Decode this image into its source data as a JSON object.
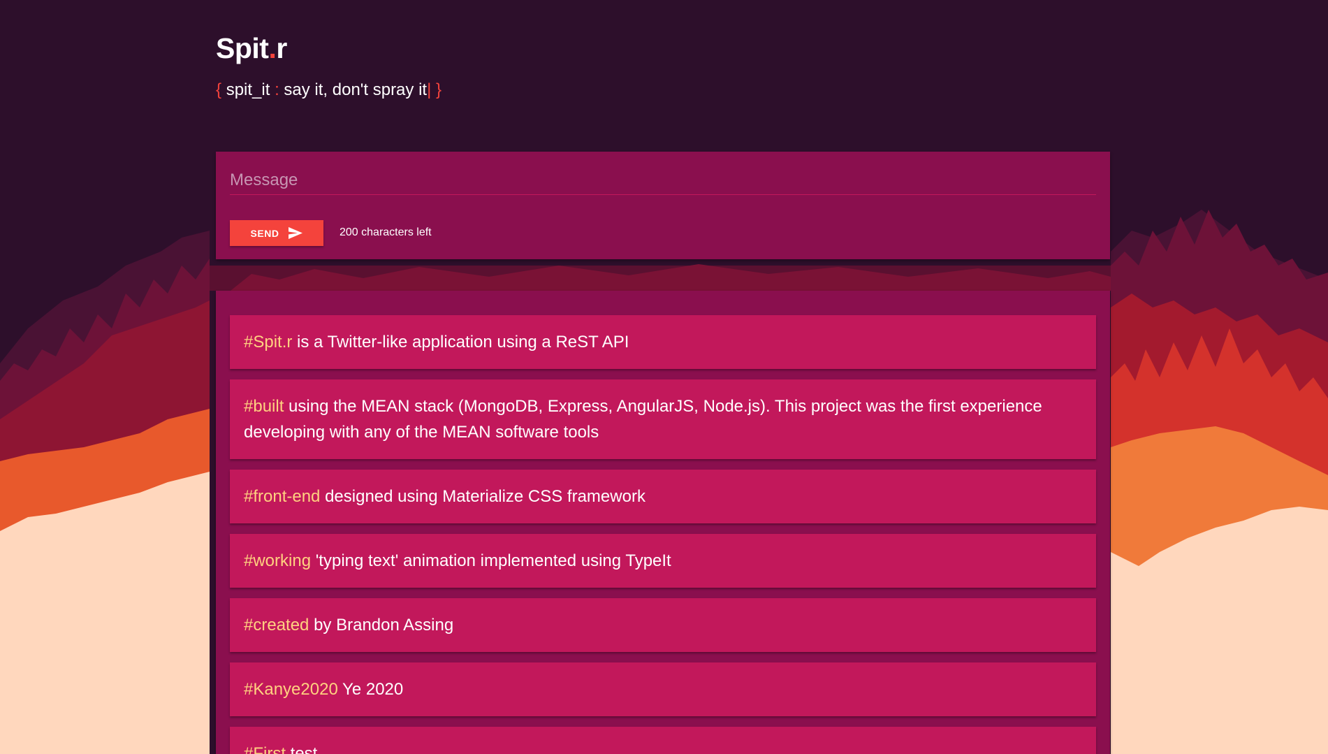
{
  "header": {
    "logo_part1": "Spit",
    "logo_dot": ".",
    "logo_part2": "r",
    "tagline_open_brace": "{",
    "tagline_key": "spit_it",
    "tagline_colon": ":",
    "tagline_text": "say it, don't spray it",
    "tagline_cursor": "|",
    "tagline_close_brace": "}"
  },
  "composer": {
    "placeholder": "Message",
    "send_label": "SEND",
    "chars_left": "200 characters left"
  },
  "posts": [
    {
      "tag": "#Spit.r",
      "text": " is a Twitter-like application using a ReST API"
    },
    {
      "tag": "#built",
      "text": " using the MEAN stack (MongoDB, Express, AngularJS, Node.js). This project was the first experience developing with any of the MEAN software tools"
    },
    {
      "tag": "#front-end",
      "text": " designed using Materialize CSS framework"
    },
    {
      "tag": "#working",
      "text": " 'typing text' animation implemented using TypeIt"
    },
    {
      "tag": "#created",
      "text": " by Brandon Assing"
    },
    {
      "tag": "#Kanye2020",
      "text": " Ye 2020"
    },
    {
      "tag": "#First",
      "text": " test"
    }
  ],
  "colors": {
    "background": "#2d0f2b",
    "card": "#8a0f4e",
    "post": "#c2185b",
    "accent": "#f4433c",
    "hashtag": "#ffd180"
  },
  "icons": {
    "send": "send-icon"
  }
}
